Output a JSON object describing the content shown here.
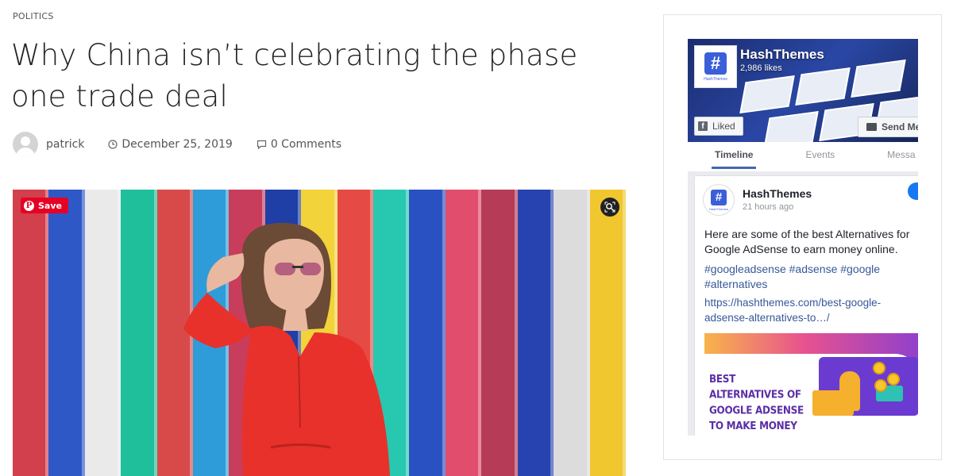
{
  "post": {
    "category": "POLITICS",
    "title": "Why China isn’t celebrating the phase one trade deal",
    "author": "patrick",
    "date": "December 25, 2019",
    "comments": "0 Comments"
  },
  "hero": {
    "pin_save_label": "Save",
    "stripe_colors": [
      "#d23f4d",
      "#2f58c7",
      "#eaeaea",
      "#1fbf9b",
      "#d84a4a",
      "#2e9cd8",
      "#c93d5c",
      "#1f3fa6",
      "#f2d33a",
      "#e54a44",
      "#28c8b0",
      "#2951c1",
      "#e14e6d",
      "#b53b56",
      "#2743b0",
      "#dcdcdc",
      "#f0c72e"
    ]
  },
  "facebook_widget": {
    "page_name": "HashThemes",
    "likes": "2,986 likes",
    "logo_sub": "HashThemes",
    "liked_label": "Liked",
    "send_label": "Send Me",
    "tabs": [
      {
        "label": "Timeline",
        "active": true
      },
      {
        "label": "Events",
        "active": false
      },
      {
        "label": "Messa",
        "active": false
      }
    ],
    "post": {
      "author": "HashThemes",
      "time": "21 hours ago",
      "text": "Here are some of the best Alternatives for Google AdSense to earn money online.",
      "tags": "#googleadsense #adsense #google #alternatives",
      "link": "https://hashthemes.com/best-google-adsense-alternatives-to…/",
      "banner_text": "BEST ALTERNATIVES OF GOOGLE ADSENSE TO MAKE MONEY ONLINE"
    }
  },
  "colors": {
    "fb_blue": "#4267b2",
    "link_blue": "#365899",
    "pinterest_red": "#e60023"
  }
}
